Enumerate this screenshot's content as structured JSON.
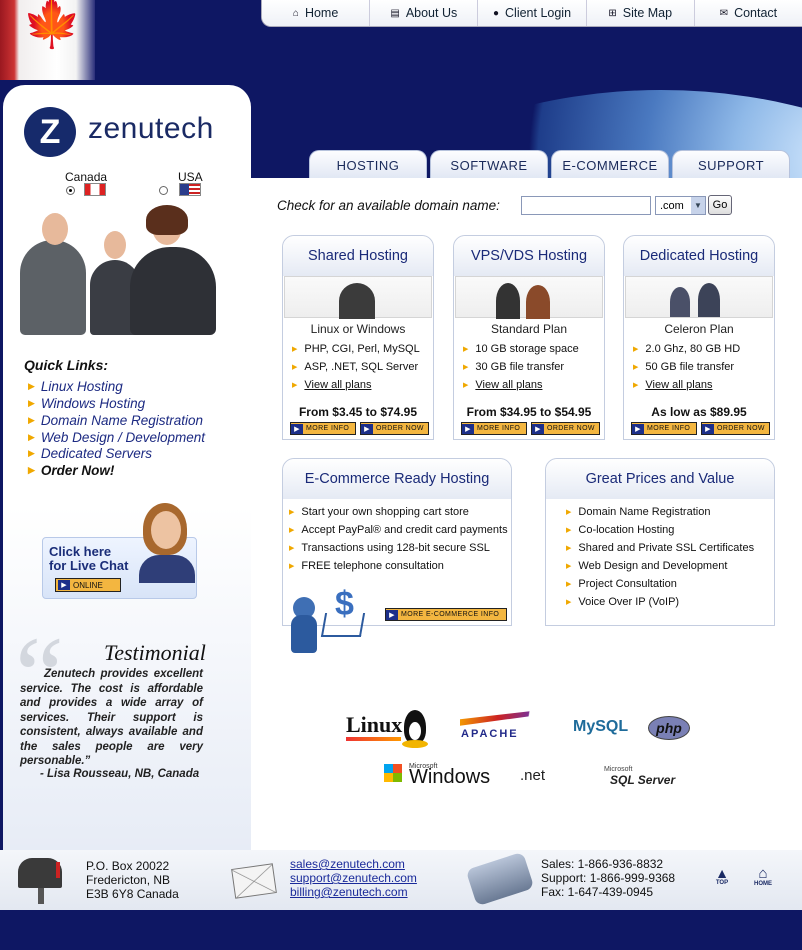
{
  "topnav": [
    {
      "label": "Home",
      "icon": "home-icon"
    },
    {
      "label": "About Us",
      "icon": "document-icon"
    },
    {
      "label": "Client Login",
      "icon": "user-icon"
    },
    {
      "label": "Site Map",
      "icon": "sitemap-icon"
    },
    {
      "label": "Contact",
      "icon": "envelope-icon"
    }
  ],
  "logo": {
    "mark": "Z",
    "text": "zenutech"
  },
  "countries": [
    {
      "label": "Canada",
      "selected": true
    },
    {
      "label": "USA",
      "selected": false
    }
  ],
  "main_tabs": [
    "HOSTING",
    "SOFTWARE",
    "E-COMMERCE",
    "SUPPORT"
  ],
  "domain_check": {
    "label": "Check for an available domain name:",
    "value": "",
    "tld": ".com",
    "go": "Go"
  },
  "quick_links": {
    "title": "Quick Links:",
    "items": [
      "Linux Hosting",
      "Windows Hosting",
      "Domain Name Registration",
      "Web Design / Development",
      "Dedicated Servers",
      "Order Now!"
    ]
  },
  "live_chat": {
    "line1": "Click here",
    "line2": "for Live Chat",
    "button": "ONLINE"
  },
  "testimonial": {
    "title": "Testimonial",
    "body": "Zenutech provides excellent service. The cost is affordable and provides a wide array of services. Their support is consistent, always available and the sales people are very personable.”",
    "author": "- Lisa Rousseau, NB, Canada"
  },
  "plans": [
    {
      "title": "Shared Hosting",
      "subtitle": "Linux or Windows",
      "features": [
        "PHP, CGI, Perl, MySQL",
        "ASP, .NET, SQL Server"
      ],
      "link": "View all plans",
      "price": "From $3.45 to $74.95"
    },
    {
      "title": "VPS/VDS Hosting",
      "subtitle": "Standard Plan",
      "features": [
        "10 GB storage space",
        "30 GB file transfer"
      ],
      "link": "View all plans",
      "price": "From $34.95 to $54.95"
    },
    {
      "title": "Dedicated Hosting",
      "subtitle": "Celeron Plan",
      "features": [
        "2.0 Ghz, 80 GB HD",
        "50 GB file transfer"
      ],
      "link": "View all plans",
      "price": "As low as $89.95"
    }
  ],
  "plan_buttons": {
    "more": "MORE INFO",
    "order": "ORDER NOW"
  },
  "ecommerce": {
    "title": "E-Commerce Ready Hosting",
    "features": [
      "Start your own shopping cart store",
      "Accept PayPal® and credit card payments",
      "Transactions using 128-bit  secure SSL",
      "FREE telephone consultation"
    ],
    "button": "MORE E-COMMERCE INFO"
  },
  "prices": {
    "title": "Great Prices and Value",
    "features": [
      "Domain Name Registration",
      "Co-location Hosting",
      "Shared and Private SSL Certificates",
      "Web Design and Development",
      "Project Consultation",
      "Voice Over IP (VoIP)"
    ]
  },
  "tech_logos": {
    "linux": "Linux",
    "apache": "APACHE",
    "mysql": "MySQL",
    "php": "php",
    "ms": "Microsoft",
    "windows": "Windows",
    "net": ".net",
    "sql": "SQL Server"
  },
  "footer": {
    "address": [
      "P.O. Box 20022",
      "Fredericton, NB",
      "E3B 6Y8 Canada"
    ],
    "emails": [
      "sales@zenutech.com",
      "support@zenutech.com",
      "billing@zenutech.com"
    ],
    "phones": [
      "Sales: 1-866-936-8832",
      "Support:  1-866-999-9368",
      "Fax: 1-647-439-0945"
    ],
    "top": "TOP",
    "home": "HOME"
  },
  "colors": {
    "navy": "#0e1763",
    "accent": "#f3b640",
    "link": "#1c2a82"
  }
}
